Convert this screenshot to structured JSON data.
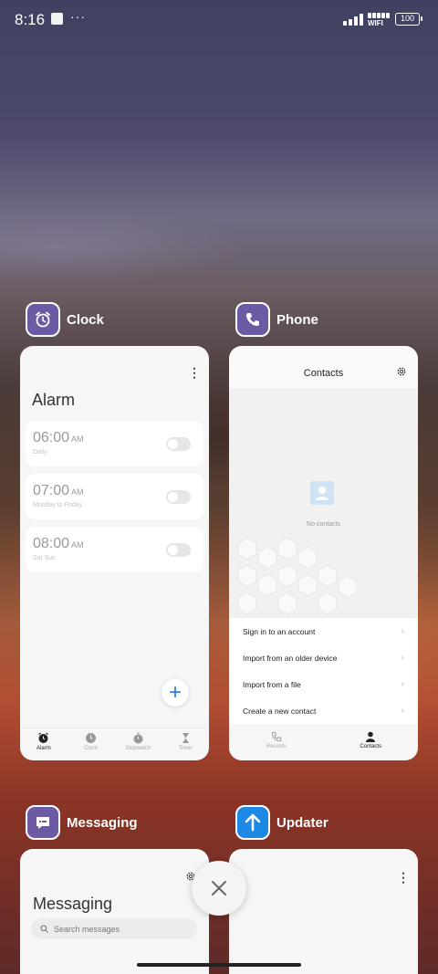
{
  "status_bar": {
    "time": "8:16",
    "dots": "···",
    "wifi_label": "WIFI",
    "battery": "100"
  },
  "apps": [
    {
      "name": "Clock",
      "icon": "alarm-clock-icon",
      "icon_color": "#6d5aa5",
      "screen": {
        "heading": "Alarm",
        "alarms": [
          {
            "time": "06:00",
            "ampm": "AM",
            "repeat": "Daily",
            "enabled": false
          },
          {
            "time": "07:00",
            "ampm": "AM",
            "repeat": "Monday to Friday",
            "enabled": false
          },
          {
            "time": "08:00",
            "ampm": "AM",
            "repeat": "Sat Sun",
            "enabled": false
          }
        ],
        "fab": "+",
        "tabs": [
          {
            "label": "Alarm",
            "icon": "alarm-icon",
            "active": true
          },
          {
            "label": "Clock",
            "icon": "clock-icon",
            "active": false
          },
          {
            "label": "Stopwatch",
            "icon": "stopwatch-icon",
            "active": false
          },
          {
            "label": "Timer",
            "icon": "hourglass-icon",
            "active": false
          }
        ]
      }
    },
    {
      "name": "Phone",
      "icon": "phone-icon",
      "icon_color": "#6d5aa5",
      "screen": {
        "title": "Contacts",
        "empty_text": "No contacts",
        "actions": [
          "Sign in to an account",
          "Import from an older device",
          "Import from a file",
          "Create a new contact"
        ],
        "tabs": [
          {
            "label": "Recents",
            "icon": "phone-icon",
            "active": false
          },
          {
            "label": "Contacts",
            "icon": "person-icon",
            "active": true
          }
        ]
      }
    },
    {
      "name": "Messaging",
      "icon": "message-icon",
      "icon_color": "#6d5aa5",
      "screen": {
        "heading": "Messaging",
        "search_placeholder": "Search messages"
      }
    },
    {
      "name": "Updater",
      "icon": "arrow-up-icon",
      "icon_color": "#1e88e5"
    }
  ],
  "close_all": "close-icon",
  "accent": "#2f7fe0"
}
